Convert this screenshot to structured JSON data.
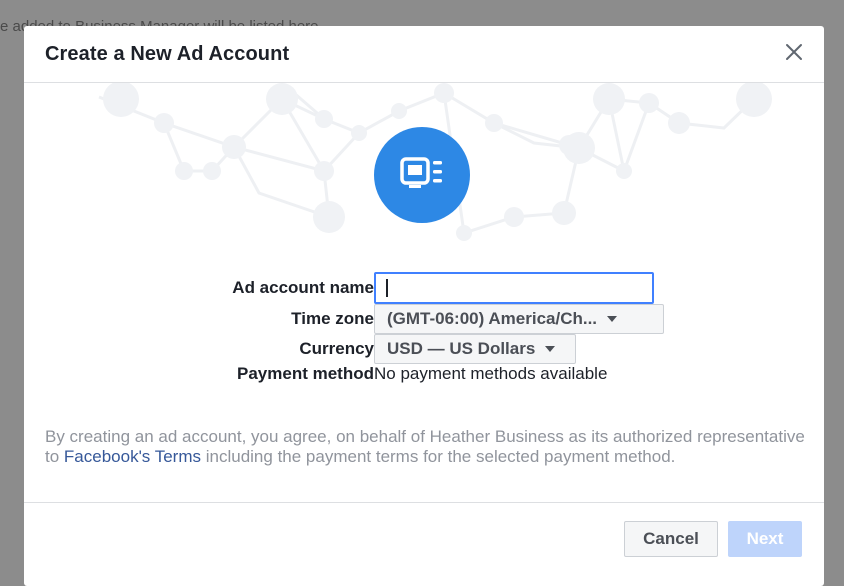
{
  "background": {
    "text": "e added to Business Manager will be listed here."
  },
  "modal": {
    "title": "Create a New Ad Account",
    "close_icon": "close-icon",
    "hero_icon": "ad-account-icon",
    "accent_color": "#2d88e5"
  },
  "form": {
    "ad_account_name": {
      "label": "Ad account name",
      "value": "",
      "placeholder": ""
    },
    "time_zone": {
      "label": "Time zone",
      "value": "(GMT-06:00) America/Ch..."
    },
    "currency": {
      "label": "Currency",
      "value": "USD — US Dollars"
    },
    "payment_method": {
      "label": "Payment method",
      "value": "No payment methods available"
    }
  },
  "disclaimer": {
    "before": "By creating an ad account, you agree, on behalf of Heather Business as its authorized representative to ",
    "link": "Facebook's Terms",
    "after": " including the payment terms for the selected payment method."
  },
  "footer": {
    "cancel_label": "Cancel",
    "next_label": "Next"
  }
}
